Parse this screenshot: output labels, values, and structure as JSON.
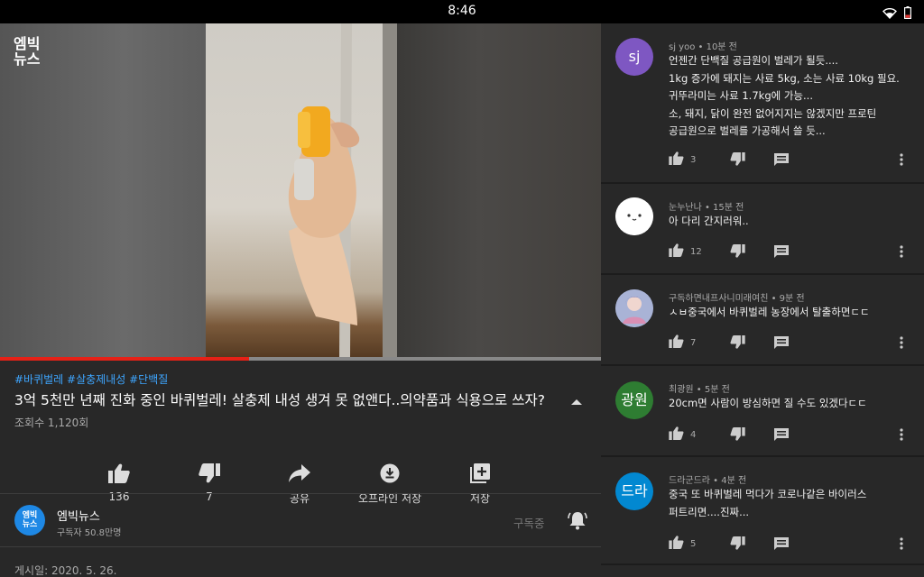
{
  "status_bar": {
    "time": "8:46",
    "wifi_icon": "wifi-icon",
    "battery_icon": "battery-low-icon"
  },
  "video": {
    "logo_line1": "엠빅",
    "logo_line2": "뉴스",
    "progress": 0.415,
    "hashtags": "#바퀴벌레 #살충제내성 #단백질",
    "title": "3억 5천만 년째 진화 중인 바퀴벌레! 살충제 내성 생겨 못 없앤다..의약품과 식용으로 쓰자?",
    "views": "조회수 1,120회",
    "colors": {
      "progress_played": "#e62117",
      "hashtag": "#3ea6ff"
    }
  },
  "actions": {
    "like": "136",
    "dislike": "7",
    "share": "공유",
    "offline": "오프라인 저장",
    "save": "저장"
  },
  "channel": {
    "avatar_line1": "엠빅",
    "avatar_line2": "뉴스",
    "name": "엠빅뉴스",
    "subscribers": "구독자 50.8만명",
    "subscribed": "구독중"
  },
  "posted": "게시일: 2020. 5. 26.",
  "comments": [
    {
      "avatar": "sj",
      "avatar_color": "#7e57c2",
      "meta": "sj yoo • 10분 전",
      "lines": [
        "언젠간 단백질 공급원이 벌레가 될듯....",
        "1kg 증가에 돼지는 사료 5kg, 소는 사료 10kg 필요.",
        "귀뚜라미는 사료 1.7kg에 가능...",
        "소, 돼지, 닭이 완전 없어지지는 않겠지만 프로틴",
        "공급원으로 벌레를 가공해서 쓸 듯..."
      ],
      "likes": "3"
    },
    {
      "avatar": "",
      "avatar_color": "#ffffff",
      "meta": "눈누난나 • 15분 전",
      "lines": [
        "아 다리 간지러워.."
      ],
      "likes": "12"
    },
    {
      "avatar": "",
      "avatar_color": "#9aa6c8",
      "meta": "구독하면내프사니미래여친 • 9분 전",
      "lines": [
        "ㅅㅂ중국에서 바퀴벌레 농장에서 탈출하면ㄷㄷ"
      ],
      "likes": "7"
    },
    {
      "avatar": "광원",
      "avatar_color": "#2e7d32",
      "meta": "최광원 • 5분 전",
      "lines": [
        "20cm면 사람이 방심하면 질 수도 있겠다ㄷㄷ"
      ],
      "likes": "4"
    },
    {
      "avatar": "드라",
      "avatar_color": "#0288d1",
      "meta": "드라군드라 • 4분 전",
      "lines": [
        "중국 또 바퀴벌레 먹다가 코로나같은 바이러스",
        "퍼트리면....진짜..."
      ],
      "likes": "5"
    }
  ]
}
